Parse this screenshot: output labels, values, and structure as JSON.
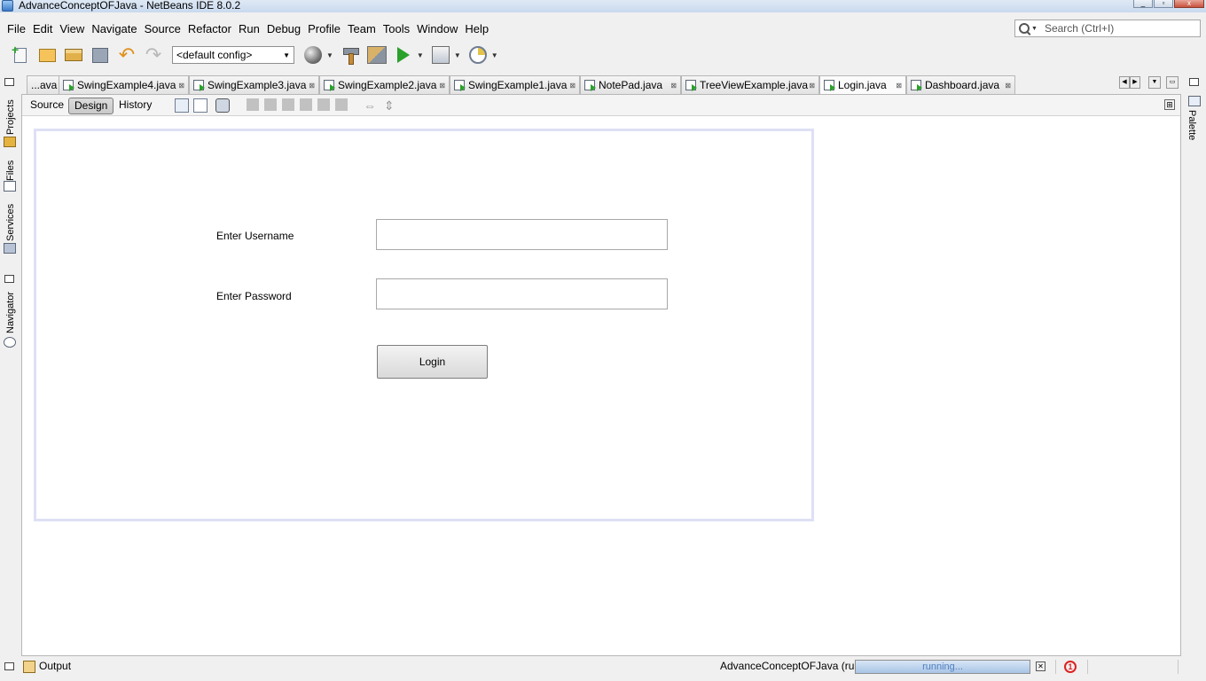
{
  "window": {
    "title": "AdvanceConceptOFJava - NetBeans IDE 8.0.2"
  },
  "menu": [
    "File",
    "Edit",
    "View",
    "Navigate",
    "Source",
    "Refactor",
    "Run",
    "Debug",
    "Profile",
    "Team",
    "Tools",
    "Window",
    "Help"
  ],
  "search": {
    "placeholder": "Search (Ctrl+I)"
  },
  "toolbar": {
    "config": "<default config>"
  },
  "side_tabs": {
    "projects": "Projects",
    "files": "Files",
    "services": "Services",
    "navigator": "Navigator",
    "palette": "Palette"
  },
  "editor_tabs": [
    "...ava",
    "SwingExample4.java",
    "SwingExample3.java",
    "SwingExample2.java",
    "SwingExample1.java",
    "NotePad.java",
    "TreeViewExample.java",
    "Login.java",
    "Dashboard.java"
  ],
  "active_tab": "Login.java",
  "view_tabs": {
    "source": "Source",
    "design": "Design",
    "history": "History"
  },
  "form": {
    "username_label": "Enter Username",
    "password_label": "Enter Password",
    "username_value": "",
    "password_value": "",
    "login_button": "Login"
  },
  "status": {
    "output": "Output",
    "task": "AdvanceConceptOFJava (run)",
    "progress_text": "running...",
    "notifications": "1"
  }
}
